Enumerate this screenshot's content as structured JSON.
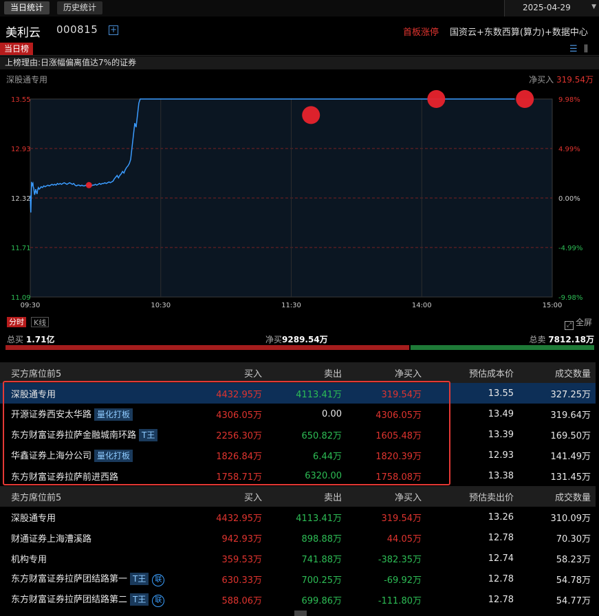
{
  "tabs": [
    {
      "label": "当日统计"
    },
    {
      "label": "历史统计"
    }
  ],
  "date": "2025-04-29",
  "stock": {
    "name": "美利云",
    "code": "000815",
    "first_limit": "首板涨停",
    "concepts": "国资云+东数西算(算力)+数据中心"
  },
  "board": {
    "tag": "当日榜",
    "reason": "上榜理由:日涨幅偏离值达7%的证券"
  },
  "chart_header": {
    "seat": "深股通专用",
    "net_label": "净买入",
    "net_value": "319.54万"
  },
  "chart_data": {
    "type": "line",
    "y_left_ticks": [
      "13.55",
      "12.93",
      "12.32",
      "11.71",
      "11.09"
    ],
    "y_right_ticks": [
      "9.98%",
      "4.99%",
      "0.00%",
      "-4.99%",
      "-9.98%"
    ],
    "x_ticks": [
      "09:30",
      "10:30",
      "11:30",
      "14:00",
      "15:00"
    ],
    "ylim": [
      11.09,
      13.55
    ],
    "prev_close": 12.32,
    "x": [
      0,
      1,
      2,
      4,
      5,
      7,
      10,
      11,
      13,
      15,
      16,
      18,
      20,
      21,
      23,
      25,
      27,
      30,
      33,
      36,
      40,
      45,
      50,
      55,
      60,
      65,
      70,
      75,
      80,
      85,
      90,
      95,
      100,
      105,
      110,
      115,
      120,
      125,
      130,
      135,
      140,
      145,
      150,
      155,
      160,
      165,
      170,
      175,
      180,
      185,
      190,
      195,
      200,
      205,
      210,
      215,
      220,
      225,
      230,
      235,
      240,
      245,
      250,
      255,
      260,
      265,
      270,
      275,
      280,
      285,
      290,
      295,
      300,
      305,
      310,
      315,
      320,
      325,
      330,
      335,
      340,
      345,
      350,
      355,
      360,
      365,
      370,
      375,
      380,
      385,
      390,
      395,
      400,
      405,
      410,
      415,
      420,
      425,
      430,
      435,
      440,
      445,
      450,
      455,
      460,
      465,
      470,
      475,
      480,
      485,
      490,
      495,
      500,
      505,
      510,
      515,
      520,
      525,
      530,
      535,
      540,
      545,
      550,
      555,
      560,
      565,
      570,
      575,
      580,
      585,
      590,
      595,
      600,
      605,
      610,
      615,
      620,
      625,
      630,
      635,
      640,
      645,
      650,
      655,
      660,
      665,
      670,
      675,
      680,
      685,
      690,
      695,
      700,
      705,
      710,
      715,
      720,
      725,
      730,
      735,
      740,
      745,
      750,
      755,
      760,
      765,
      770,
      775,
      780,
      785,
      790,
      795,
      800,
      805,
      810,
      815,
      820,
      825,
      830,
      835,
      840,
      845,
      850,
      855,
      860,
      865,
      870,
      875,
      880,
      885,
      890,
      895,
      900,
      905,
      910,
      915,
      920,
      925,
      930,
      935,
      940,
      945,
      950,
      955,
      960,
      965,
      970,
      975,
      980,
      985,
      990,
      995,
      1000,
      1005,
      1010,
      1015,
      1020,
      1025,
      1030,
      1035,
      1040,
      1045,
      1050,
      1055,
      1060,
      1065,
      1070,
      1075,
      1080,
      1085,
      1090,
      1095,
      1100,
      1105,
      1110,
      1115,
      1120,
      1125,
      1130,
      1135,
      1140,
      1145,
      1150,
      1155,
      1160,
      1165,
      1170,
      1175,
      1180,
      1185,
      1190,
      1195,
      1200
    ],
    "y": [
      12.35,
      12.22,
      12.14,
      12.42,
      12.52,
      12.48,
      12.5,
      12.46,
      12.44,
      12.38,
      12.36,
      12.39,
      12.43,
      12.41,
      12.39,
      12.37,
      12.42,
      12.45,
      12.43,
      12.44,
      12.46,
      12.45,
      12.47,
      12.46,
      12.47,
      12.48,
      12.47,
      12.48,
      12.49,
      12.48,
      12.49,
      12.48,
      12.5,
      12.49,
      12.5,
      12.49,
      12.5,
      12.51,
      12.5,
      12.49,
      12.5,
      12.51,
      12.5,
      12.49,
      12.5,
      12.48,
      12.47,
      12.48,
      12.48,
      12.47,
      12.48,
      12.47,
      12.47,
      12.48,
      12.47,
      12.48,
      12.48,
      12.47,
      12.48,
      12.48,
      12.49,
      12.48,
      12.49,
      12.5,
      12.49,
      12.5,
      12.5,
      12.51,
      12.5,
      12.51,
      12.52,
      12.51,
      12.52,
      12.53,
      12.56,
      12.58,
      12.6,
      12.57,
      12.6,
      12.62,
      12.65,
      12.63,
      12.67,
      12.7,
      12.72,
      12.75,
      12.8,
      12.95,
      13.1,
      13.25,
      13.2,
      13.35,
      13.5,
      13.55,
      13.55,
      13.55,
      13.55,
      13.55,
      13.55,
      13.55,
      13.55,
      13.55,
      13.55,
      13.55,
      13.55,
      13.55,
      13.55,
      13.55,
      13.55,
      13.55,
      13.55,
      13.55,
      13.55,
      13.55,
      13.55,
      13.55,
      13.55,
      13.55,
      13.55,
      13.55,
      13.55,
      13.55,
      13.55,
      13.55,
      13.55,
      13.55,
      13.55,
      13.55,
      13.55,
      13.55,
      13.55,
      13.55,
      13.55,
      13.55,
      13.55,
      13.55,
      13.55,
      13.55,
      13.55,
      13.55,
      13.55,
      13.55,
      13.55,
      13.55,
      13.55,
      13.55,
      13.55,
      13.55,
      13.55,
      13.55,
      13.55,
      13.55,
      13.55,
      13.55,
      13.55,
      13.55,
      13.55,
      13.55,
      13.55,
      13.55,
      13.55,
      13.55,
      13.55,
      13.55,
      13.55,
      13.55,
      13.55,
      13.55,
      13.55,
      13.55,
      13.55,
      13.55,
      13.55,
      13.55,
      13.55,
      13.55,
      13.55,
      13.55,
      13.55,
      13.55,
      13.55,
      13.55,
      13.55,
      13.55,
      13.55,
      13.55,
      13.55,
      13.55,
      13.55,
      13.55,
      13.55,
      13.55,
      13.55,
      13.55,
      13.55,
      13.55,
      13.55,
      13.55,
      13.55,
      13.55,
      13.55,
      13.55,
      13.55,
      13.55,
      13.55,
      13.55,
      13.55,
      13.55,
      13.55,
      13.55,
      13.55,
      13.55,
      13.55,
      13.55,
      13.55,
      13.55,
      13.55,
      13.55,
      13.55,
      13.55,
      13.55,
      13.55,
      13.55,
      13.55,
      13.55,
      13.55,
      13.55,
      13.55,
      13.55,
      13.55,
      13.55,
      13.55,
      13.55,
      13.55,
      13.55,
      13.55,
      13.55,
      13.55,
      13.55,
      13.55,
      13.55,
      13.55,
      13.55,
      13.55,
      13.55,
      13.55,
      13.55
    ],
    "markers": [
      {
        "x": 208,
        "y": 12.48,
        "size": "small"
      },
      {
        "x": 995,
        "y": 13.35,
        "size": "large"
      },
      {
        "x": 1439,
        "y": 13.55,
        "size": "large"
      },
      {
        "x": 1753,
        "y": 13.55,
        "size": "large"
      }
    ],
    "x_extent": [
      0,
      1850
    ]
  },
  "chart_toggle": {
    "fenshi": "分时",
    "kline": "K线",
    "fullscreen": "全屏"
  },
  "flow": {
    "total_buy_label": "总买",
    "total_buy": "1.71亿",
    "net_buy_label": "净买",
    "net_buy": "9289.54万",
    "total_sell_label": "总卖",
    "total_sell": "7812.18万",
    "buy_fraction": 0.686
  },
  "buy_table": {
    "headers": [
      "买方席位前5",
      "买入",
      "卖出",
      "净买入",
      "预估成本价",
      "成交数量"
    ],
    "rows": [
      {
        "name": "深股通专用",
        "badge": "",
        "buy": "4432.95万",
        "sell": "4113.41万",
        "net": "319.54万",
        "price": "13.55",
        "vol": "327.25万"
      },
      {
        "name": "开源证券西安太华路",
        "badge": "量化打板",
        "buy": "4306.05万",
        "sell": "0.00",
        "net": "4306.05万",
        "price": "13.49",
        "vol": "319.64万"
      },
      {
        "name": "东方财富证券拉萨金融城南环路",
        "badge": "T王",
        "buy": "2256.30万",
        "sell": "650.82万",
        "net": "1605.48万",
        "price": "13.39",
        "vol": "169.50万"
      },
      {
        "name": "华鑫证券上海分公司",
        "badge": "量化打板",
        "buy": "1826.84万",
        "sell": "6.44万",
        "net": "1820.39万",
        "price": "12.93",
        "vol": "141.49万"
      },
      {
        "name": "东方财富证券拉萨前进西路",
        "badge": "",
        "buy": "1758.71万",
        "sell": "6320.00",
        "net": "1758.08万",
        "price": "13.38",
        "vol": "131.45万"
      }
    ]
  },
  "sell_table": {
    "headers": [
      "卖方席位前5",
      "买入",
      "卖出",
      "净买入",
      "预估卖出价",
      "成交数量"
    ],
    "rows": [
      {
        "name": "深股通专用",
        "badge": "",
        "lian": "",
        "buy": "4432.95万",
        "sell": "4113.41万",
        "net": "319.54万",
        "price": "13.26",
        "vol": "310.09万"
      },
      {
        "name": "财通证券上海漕溪路",
        "badge": "",
        "lian": "",
        "buy": "942.93万",
        "sell": "898.88万",
        "net": "44.05万",
        "price": "12.78",
        "vol": "70.30万"
      },
      {
        "name": "机构专用",
        "badge": "",
        "lian": "",
        "buy": "359.53万",
        "sell": "741.88万",
        "net": "-382.35万",
        "price": "12.74",
        "vol": "58.23万"
      },
      {
        "name": "东方财富证券拉萨团结路第一",
        "badge": "T王",
        "lian": "联",
        "buy": "630.33万",
        "sell": "700.25万",
        "net": "-69.92万",
        "price": "12.78",
        "vol": "54.78万"
      },
      {
        "name": "东方财富证券拉萨团结路第二",
        "badge": "T王",
        "lian": "联",
        "buy": "588.06万",
        "sell": "699.86万",
        "net": "-111.80万",
        "price": "12.78",
        "vol": "54.77万"
      }
    ]
  },
  "colors": {
    "up": "#e0342f",
    "down": "#2dbd55",
    "line": "#3b9cff",
    "accent": "#b71c1c"
  }
}
